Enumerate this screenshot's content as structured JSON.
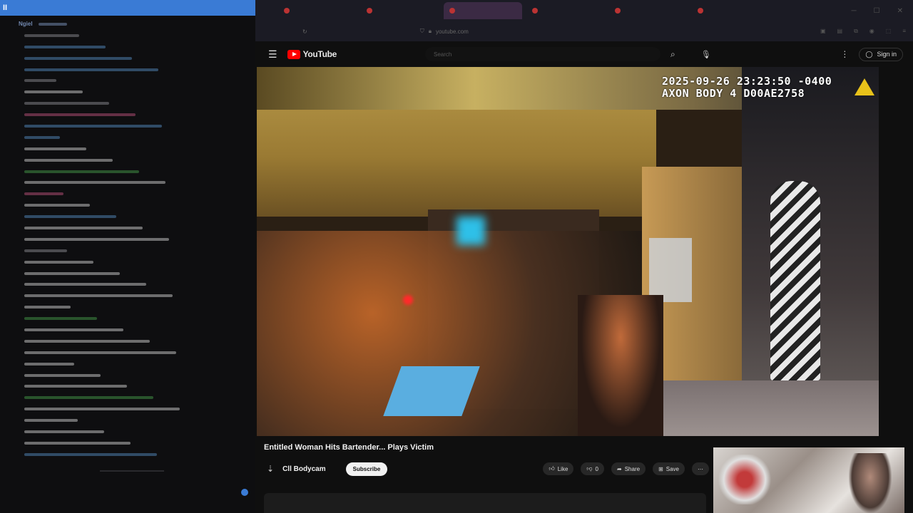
{
  "chat": {
    "topbar_icon": "pause-icon",
    "lines": [
      {
        "user": "Ngiel",
        "msg": "",
        "color": "#8aa6d6"
      },
      {
        "user": "",
        "msg": "",
        "color": "#9a9aa0"
      },
      {
        "user": "",
        "msg": "",
        "color": "#5c9bd6"
      },
      {
        "user": "",
        "msg": "",
        "color": "#5c9bd6"
      },
      {
        "user": "",
        "msg": "",
        "color": "#5c9bd6"
      },
      {
        "user": "",
        "msg": "",
        "color": "#9a9aa0"
      },
      {
        "user": "",
        "msg": "",
        "color": "#e8e8e8"
      },
      {
        "user": "",
        "msg": "",
        "color": "#9a9aa0"
      },
      {
        "user": "",
        "msg": "",
        "color": "#d45a8a"
      },
      {
        "user": "",
        "msg": "",
        "color": "#5c9bd6"
      },
      {
        "user": "",
        "msg": "",
        "color": "#5c9bd6"
      },
      {
        "user": "",
        "msg": "",
        "color": "#e8e8e8"
      },
      {
        "user": "",
        "msg": "",
        "color": "#e8e8e8"
      },
      {
        "user": "",
        "msg": "",
        "color": "#4caf50"
      },
      {
        "user": "",
        "msg": "",
        "color": "#e8e8e8"
      },
      {
        "user": "",
        "msg": "",
        "color": "#d45a8a"
      },
      {
        "user": "",
        "msg": "",
        "color": "#e8e8e8"
      },
      {
        "user": "",
        "msg": "",
        "color": "#5c9bd6"
      },
      {
        "user": "",
        "msg": "",
        "color": "#e8e8e8"
      },
      {
        "user": "",
        "msg": "",
        "color": "#e8e8e8"
      },
      {
        "user": "",
        "msg": "",
        "color": "#9a9aa0"
      },
      {
        "user": "",
        "msg": "",
        "color": "#e8e8e8"
      },
      {
        "user": "",
        "msg": "",
        "color": "#e8e8e8"
      },
      {
        "user": "",
        "msg": "",
        "color": "#e8e8e8"
      },
      {
        "user": "",
        "msg": "",
        "color": "#e8e8e8"
      },
      {
        "user": "",
        "msg": "",
        "color": "#e8e8e8"
      },
      {
        "user": "",
        "msg": "",
        "color": "#4caf50"
      },
      {
        "user": "",
        "msg": "",
        "color": "#e8e8e8"
      },
      {
        "user": "",
        "msg": "",
        "color": "#e8e8e8"
      },
      {
        "user": "",
        "msg": "",
        "color": "#e8e8e8"
      },
      {
        "user": "",
        "msg": "",
        "color": "#e8e8e8"
      },
      {
        "user": "",
        "msg": "",
        "color": "#e8e8e8"
      },
      {
        "user": "",
        "msg": "",
        "color": "#e8e8e8"
      },
      {
        "user": "",
        "msg": "",
        "color": "#4caf50"
      },
      {
        "user": "",
        "msg": "",
        "color": "#e8e8e8"
      },
      {
        "user": "",
        "msg": "",
        "color": "#e8e8e8"
      },
      {
        "user": "",
        "msg": "",
        "color": "#e8e8e8"
      },
      {
        "user": "",
        "msg": "",
        "color": "#e8e8e8"
      },
      {
        "user": "",
        "msg": "",
        "color": "#5c9bd6"
      }
    ]
  },
  "browser": {
    "tabs": [
      {
        "label": "",
        "active": false
      },
      {
        "label": "",
        "active": false
      },
      {
        "label": "",
        "active": true
      },
      {
        "label": "",
        "active": false
      },
      {
        "label": "",
        "active": false
      },
      {
        "label": "",
        "active": false
      }
    ],
    "url": "youtube.com"
  },
  "youtube": {
    "logo_text": "YouTube",
    "search_placeholder": "Search",
    "signin_label": "Sign in",
    "video_overlay": "2025-09-26 23:23:50 -0400\nAXON BODY 4 D00AE2758",
    "title": "Entitled Woman Hits Bartender... Plays Victim",
    "channel": "Cll Bodycam",
    "subscribe_label": "Subscribe",
    "actions": [
      {
        "icon": "like-icon",
        "label": "Like"
      },
      {
        "icon": "dislike-icon",
        "label": "0"
      },
      {
        "icon": "share-icon",
        "label": "Share"
      },
      {
        "icon": "save-icon",
        "label": "Save"
      }
    ],
    "description_meta": "",
    "description": ""
  },
  "colors": {
    "accent_blue": "#3a7bd5",
    "yt_red": "#ff0000",
    "axon_yellow": "#e8c21a"
  }
}
